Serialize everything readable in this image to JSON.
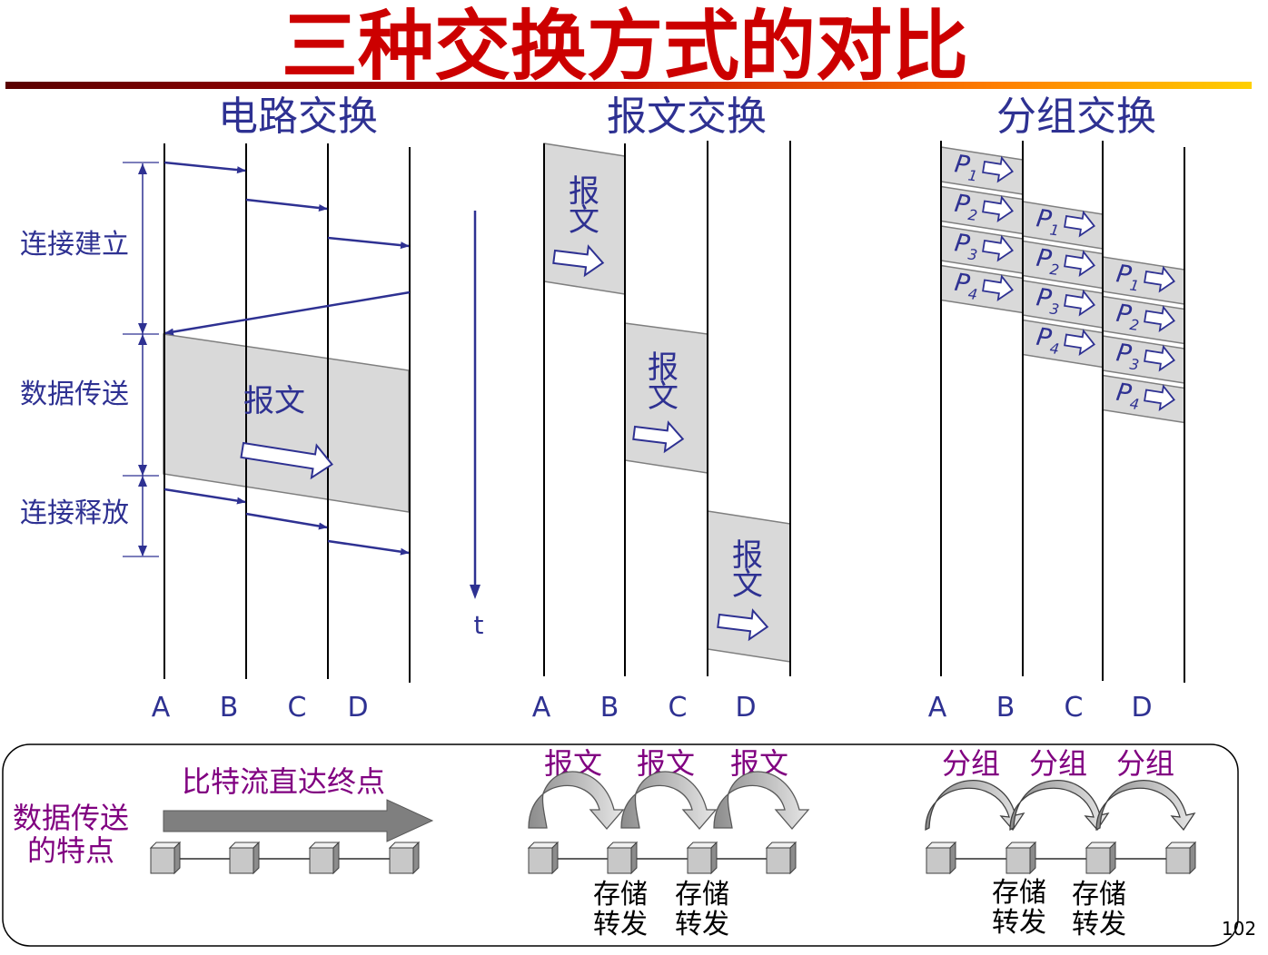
{
  "title": "三种交换方式的对比",
  "colors": {
    "title": "#cc0000",
    "heading": "#2e3192",
    "purple": "#800080",
    "arrow": "#2e3192",
    "box_fill": "#d9d9d9",
    "box_stroke": "#7f7f7f",
    "line": "#000000"
  },
  "sections": {
    "circuit": {
      "heading": "电路交换",
      "nodes": [
        "A",
        "B",
        "C",
        "D"
      ],
      "message": "报文",
      "phases": [
        "连接建立",
        "数据传送",
        "连接释放"
      ]
    },
    "message": {
      "heading": "报文交换",
      "nodes": [
        "A",
        "B",
        "C",
        "D"
      ],
      "message": "报文"
    },
    "packet": {
      "heading": "分组交换",
      "nodes": [
        "A",
        "B",
        "C",
        "D"
      ],
      "packet_letter": "P",
      "packet_numbers": [
        "1",
        "2",
        "3",
        "4"
      ]
    }
  },
  "time_label": "t",
  "bottom": {
    "side_label_line1": "数据传送",
    "side_label_line2": "的特点",
    "circuit_label": "比特流直达终点",
    "message_labels": [
      "报文",
      "报文",
      "报文"
    ],
    "packet_labels": [
      "分组",
      "分组",
      "分组"
    ],
    "store_line1": "存储",
    "store_line2": "转发"
  },
  "page_number": "102"
}
